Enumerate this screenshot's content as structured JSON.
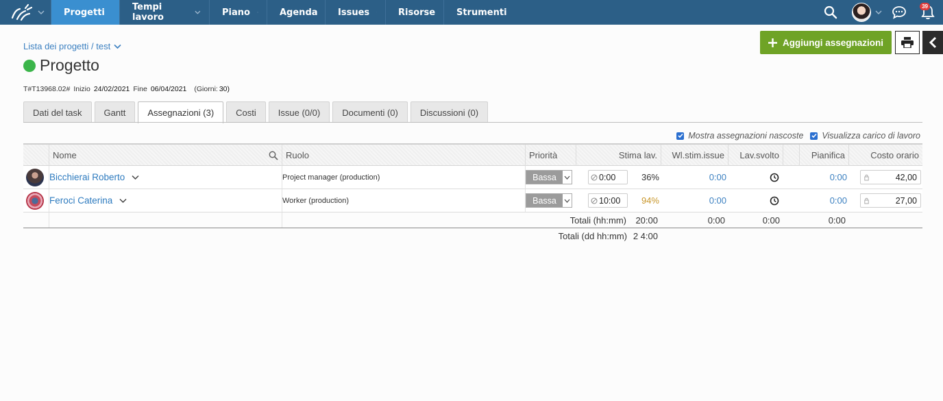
{
  "nav": {
    "items": [
      {
        "label": "Progetti",
        "active": true,
        "has_menu": true
      },
      {
        "label": "Tempi lavoro",
        "active": false,
        "has_menu": true
      },
      {
        "label": "Piano",
        "active": false,
        "has_menu": true
      },
      {
        "label": "Agenda",
        "active": false,
        "has_menu": false
      },
      {
        "label": "Issues",
        "active": false,
        "has_menu": true
      },
      {
        "label": "Risorse",
        "active": false,
        "has_menu": false
      },
      {
        "label": "Strumenti",
        "active": false,
        "has_menu": true
      }
    ],
    "notifications_count": "39",
    "icons": [
      "logo-icon",
      "search-icon",
      "avatar",
      "chat-icon",
      "bell-icon"
    ]
  },
  "header": {
    "breadcrumb": "Lista dei progetti / test",
    "title": "Progetto",
    "status_color": "#3bb54a",
    "code": "T#T13968.02#",
    "start_label": "Inizio",
    "start_date": "24/02/2021",
    "end_label": "Fine",
    "end_date": "06/04/2021",
    "days_label": "(Giorni:",
    "days_value": "30)",
    "add_button": "Aggiungi assegnazioni"
  },
  "tabs": [
    {
      "label": "Dati del task",
      "active": false
    },
    {
      "label": "Gantt",
      "active": false
    },
    {
      "label": "Assegnazioni (3)",
      "active": true
    },
    {
      "label": "Costi",
      "active": false
    },
    {
      "label": "Issue (0/0)",
      "active": false
    },
    {
      "label": "Documenti (0)",
      "active": false
    },
    {
      "label": "Discussioni (0)",
      "active": false
    }
  ],
  "options": {
    "show_hidden": "Mostra assegnazioni nascoste",
    "show_workload": "Visualizza carico di lavoro"
  },
  "table": {
    "columns": {
      "name": "Nome",
      "role": "Ruolo",
      "priority": "Priorità",
      "estimate": "Stima lav.",
      "wl_issue": "Wl.stim.issue",
      "done": "Lav.svolto",
      "plan": "Pianifica",
      "hourly_cost": "Costo orario"
    },
    "rows": [
      {
        "name": "Bicchierai Roberto",
        "role": "Project manager (production)",
        "priority": "Bassa",
        "estimate": "0:00",
        "pct": "36%",
        "wl_issue": "0:00",
        "plan": "0:00",
        "cost": "42,00"
      },
      {
        "name": "Feroci Caterina",
        "role": "Worker (production)",
        "priority": "Bassa",
        "estimate": "10:00",
        "pct": "94%",
        "wl_issue": "0:00",
        "plan": "0:00",
        "cost": "27,00"
      }
    ],
    "totals": {
      "label_hm": "Totali (hh:mm)",
      "estimate": "20:00",
      "wl_issue": "0:00",
      "done": "0:00",
      "plan": "0:00",
      "label_dhm": "Totali (dd hh:mm)",
      "estimate_dhm": "2 4:00"
    }
  }
}
